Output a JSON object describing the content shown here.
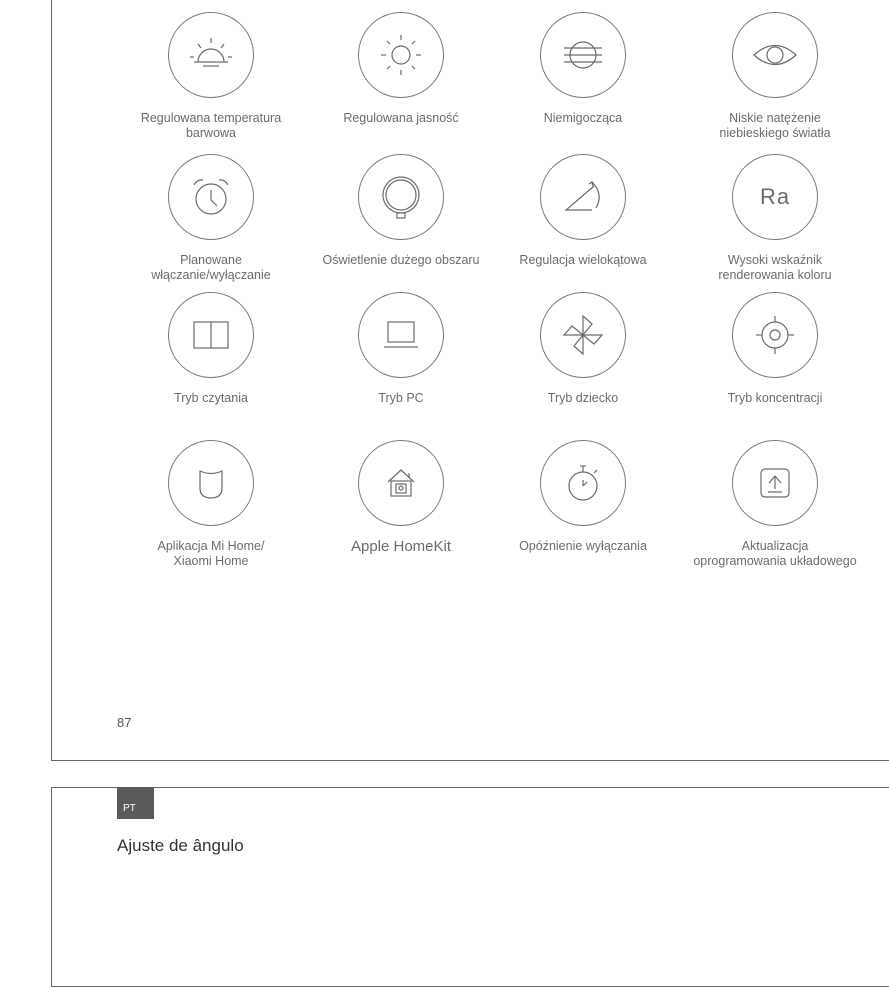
{
  "features": [
    {
      "icon": "sunrise-icon",
      "label": "Regulowana temperatura\nbarwowa"
    },
    {
      "icon": "sun-icon",
      "label": "Regulowana jasność"
    },
    {
      "icon": "flicker-free-icon",
      "label": "Niemigocząca"
    },
    {
      "icon": "eye-icon",
      "label": "Niskie natężenie\nniebieskiego światła"
    },
    {
      "icon": "alarm-clock-icon",
      "label": "Planowane\nwłączanie/wyłączanie"
    },
    {
      "icon": "lamp-circle-icon",
      "label": "Oświetlenie dużego obszaru"
    },
    {
      "icon": "angle-adjust-icon",
      "label": "Regulacja wielokątowa"
    },
    {
      "icon": "ra-icon",
      "label": "Wysoki wskaźnik\nrenderowania koloru",
      "icon_text": "Ra"
    },
    {
      "icon": "book-icon",
      "label": "Tryb czytania"
    },
    {
      "icon": "laptop-icon",
      "label": "Tryb PC"
    },
    {
      "icon": "pinwheel-icon",
      "label": "Tryb dziecko"
    },
    {
      "icon": "target-icon",
      "label": "Tryb koncentracji"
    },
    {
      "icon": "mi-home-icon",
      "label": "Aplikacja Mi Home/\nXiaomi Home"
    },
    {
      "icon": "homekit-icon",
      "label": "Apple HomeKit"
    },
    {
      "icon": "stopwatch-icon",
      "label": "Opóźnienie wyłączania"
    },
    {
      "icon": "firmware-update-icon",
      "label": "Aktualizacja\noprogramowania układowego"
    }
  ],
  "page_number": "87",
  "lang_tab": "PT",
  "next_section_title": "Ajuste de ângulo"
}
